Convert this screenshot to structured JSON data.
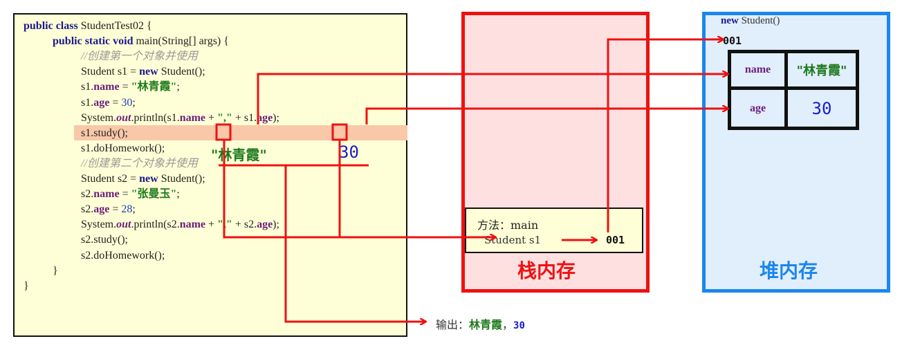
{
  "code": {
    "lines": [
      {
        "indent": 0,
        "parts": [
          [
            "kw",
            "public class "
          ],
          [
            "",
            "StudentTest02 {"
          ]
        ]
      },
      {
        "indent": 1,
        "parts": [
          [
            "kw",
            "public static void "
          ],
          [
            "",
            "main(String[] args) {"
          ]
        ]
      },
      {
        "indent": 2,
        "parts": [
          [
            "cmt",
            "//创建第一个对象并使用"
          ]
        ]
      },
      {
        "indent": 2,
        "parts": [
          [
            "",
            "Student s1 = "
          ],
          [
            "kw",
            "new "
          ],
          [
            "",
            "Student();"
          ]
        ]
      },
      {
        "indent": 2,
        "parts": [
          [
            "",
            "s1."
          ],
          [
            "field",
            "name"
          ],
          [
            "",
            " = "
          ],
          [
            "str",
            "\"林青霞\""
          ],
          [
            "",
            ";"
          ]
        ]
      },
      {
        "indent": 2,
        "parts": [
          [
            "",
            "s1."
          ],
          [
            "field",
            "age"
          ],
          [
            "",
            " = "
          ],
          [
            "num",
            "30"
          ],
          [
            "",
            ";"
          ]
        ]
      },
      {
        "indent": 2,
        "parts": [
          [
            "",
            "System."
          ],
          [
            "out",
            "out"
          ],
          [
            "",
            ".println(s1."
          ],
          [
            "field",
            "name"
          ],
          [
            "",
            " + "
          ],
          [
            "str",
            "\",\""
          ],
          [
            "",
            " + s1."
          ],
          [
            "field",
            "age"
          ],
          [
            "",
            ");"
          ]
        ]
      },
      {
        "indent": 2,
        "parts": [
          [
            "",
            "s1.study();"
          ]
        ]
      },
      {
        "indent": 2,
        "parts": [
          [
            "",
            "s1.doHomework();"
          ]
        ]
      },
      {
        "indent": 2,
        "parts": [
          [
            "cmt",
            "//创建第二个对象并使用"
          ]
        ]
      },
      {
        "indent": 2,
        "parts": [
          [
            "",
            "Student s2 = "
          ],
          [
            "kw",
            "new "
          ],
          [
            "",
            "Student();"
          ]
        ]
      },
      {
        "indent": 2,
        "parts": [
          [
            "",
            "s2."
          ],
          [
            "field",
            "name"
          ],
          [
            "",
            " = "
          ],
          [
            "str",
            "\"张曼玉\""
          ],
          [
            "",
            ";"
          ]
        ]
      },
      {
        "indent": 2,
        "parts": [
          [
            "",
            "s2."
          ],
          [
            "field",
            "age"
          ],
          [
            "",
            " = "
          ],
          [
            "num",
            "28"
          ],
          [
            "",
            ";"
          ]
        ]
      },
      {
        "indent": 2,
        "parts": [
          [
            "",
            "System."
          ],
          [
            "out",
            "out"
          ],
          [
            "",
            ".println(s2."
          ],
          [
            "field",
            "name"
          ],
          [
            "",
            " + "
          ],
          [
            "str",
            "\",\""
          ],
          [
            "",
            " + s2."
          ],
          [
            "field",
            "age"
          ],
          [
            "",
            ");"
          ]
        ]
      },
      {
        "indent": 2,
        "parts": [
          [
            "",
            "s2.study();"
          ]
        ]
      },
      {
        "indent": 2,
        "parts": [
          [
            "",
            "s2.doHomework();"
          ]
        ]
      },
      {
        "indent": 1,
        "parts": [
          [
            "",
            "}"
          ]
        ]
      },
      {
        "indent": 0,
        "parts": [
          [
            "",
            "}"
          ]
        ]
      }
    ],
    "highlighted_line": 6
  },
  "annotations": {
    "name_value": "\"林青霞\"",
    "age_value": "30"
  },
  "stack": {
    "title": "栈内存",
    "frame_method_label": "方法：main",
    "frame_var": "Student s1",
    "frame_ref": "001"
  },
  "heap": {
    "title": "堆内存",
    "new_label_kw": "new",
    "new_label_rest": "Student()",
    "address": "001",
    "fields": [
      {
        "name": "name",
        "value": "\"林青霞\""
      },
      {
        "name": "age",
        "value": "30"
      }
    ]
  },
  "output": {
    "label": "输出：",
    "name": "林青霞",
    "sep": "，",
    "age": "30"
  },
  "colors": {
    "arrow": "#ee1111",
    "stack_border": "#ee1111",
    "heap_border": "#1a86ee",
    "code_bg": "#ffffd7"
  }
}
